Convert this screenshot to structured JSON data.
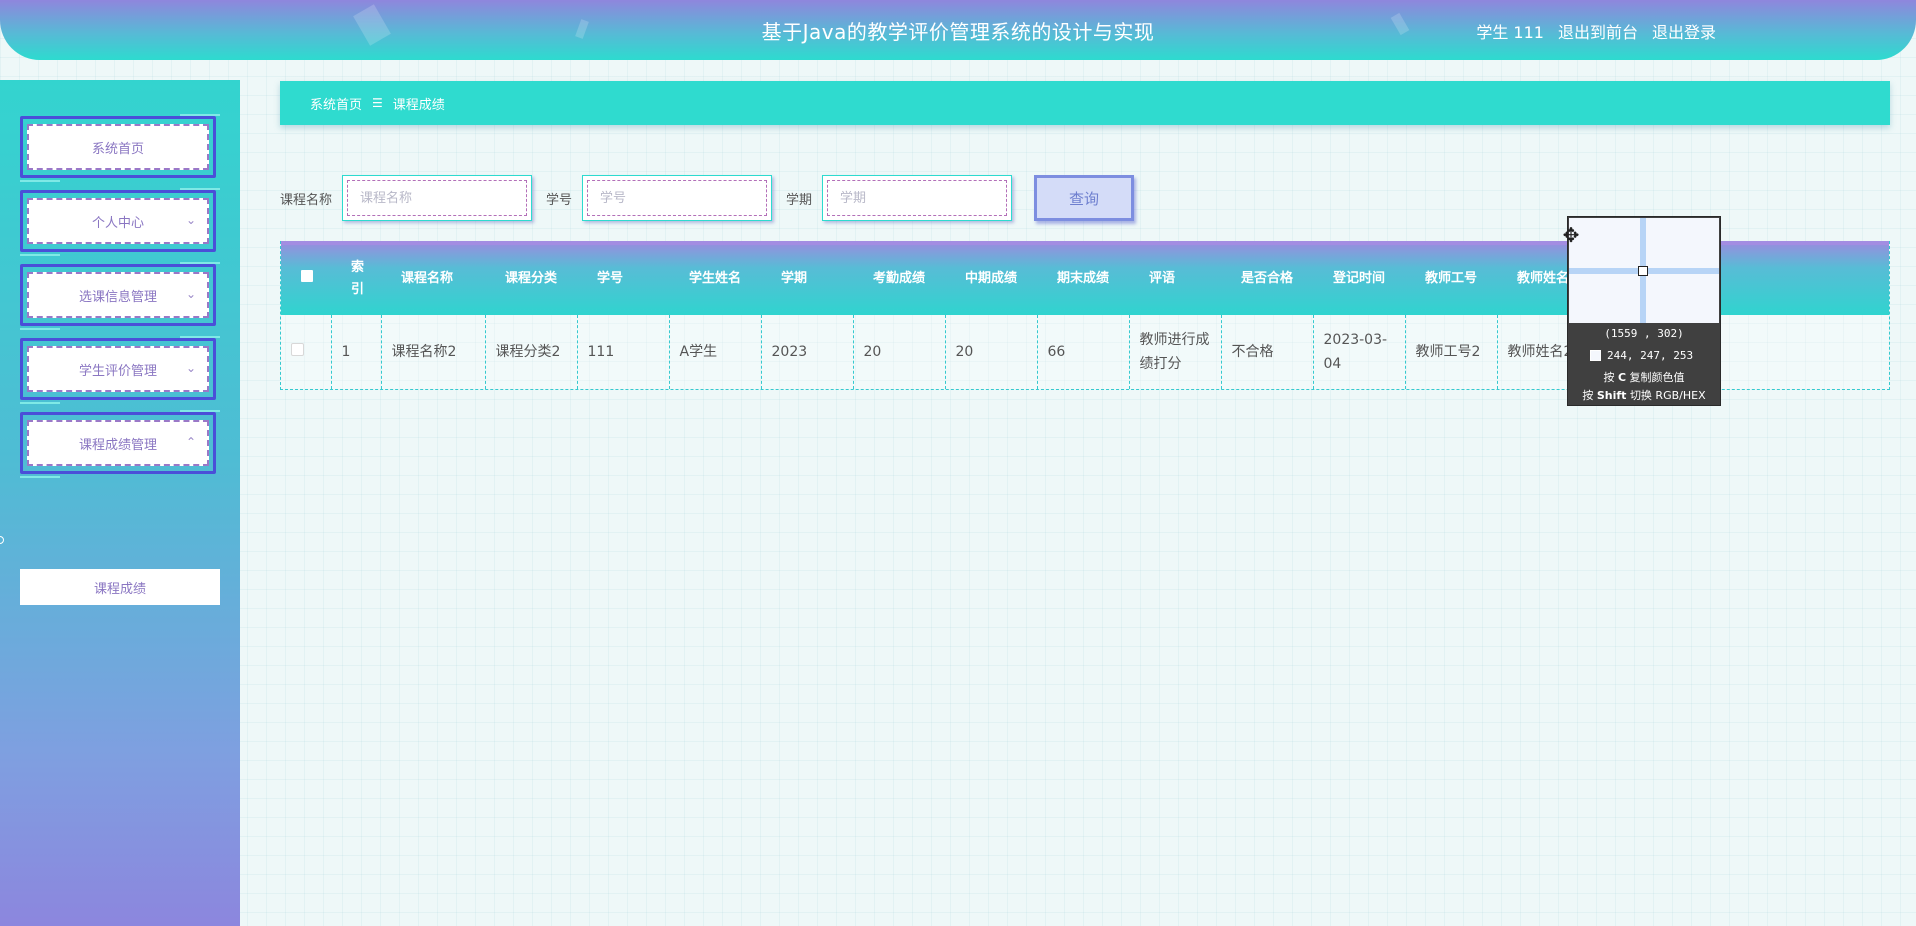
{
  "header": {
    "title": "基于Java的教学评价管理系统的设计与实现",
    "user_label": "学生 111",
    "front_link": "退出到前台",
    "logout_link": "退出登录"
  },
  "sidebar": {
    "items": [
      {
        "label": "系统首页",
        "has_chevron": false
      },
      {
        "label": "个人中心",
        "chevron": "⌄"
      },
      {
        "label": "选课信息管理",
        "chevron": "⌄"
      },
      {
        "label": "学生评价管理",
        "chevron": "⌄"
      },
      {
        "label": "课程成绩管理",
        "chevron": "⌃"
      }
    ],
    "submenu_item": "课程成绩"
  },
  "breadcrumb": {
    "home": "系统首页",
    "separator": "☰",
    "current": "课程成绩"
  },
  "search": {
    "course_label": "课程名称",
    "course_placeholder": "课程名称",
    "student_no_label": "学号",
    "student_no_placeholder": "学号",
    "term_label": "学期",
    "term_placeholder": "学期",
    "query_button": "查询"
  },
  "table": {
    "headers": [
      "索引",
      "课程名称",
      "课程分类",
      "学号",
      "学生姓名",
      "学期",
      "考勤成绩",
      "中期成绩",
      "期末成绩",
      "评语",
      "是否合格",
      "登记时间",
      "教师工号",
      "教师姓名"
    ],
    "rows": [
      {
        "index": "1",
        "course_name": "课程名称2",
        "course_category": "课程分类2",
        "student_no": "111",
        "student_name": "A学生",
        "term": "2023",
        "attendance_score": "20",
        "midterm_score": "20",
        "final_score": "66",
        "comment": "教师进行成绩打分",
        "passed": "不合格",
        "register_time": "2023-03-04",
        "teacher_no": "教师工号2",
        "teacher_name": "教师姓名2"
      }
    ]
  },
  "color_picker": {
    "coords": "(1559 , 302)",
    "rgb": "244, 247, 253",
    "swatch_color": "#f4f7fd",
    "hint_copy_prefix": "按",
    "hint_copy_key": "C",
    "hint_copy_suffix": "复制颜色值",
    "hint_toggle_prefix": "按",
    "hint_toggle_key": "Shift",
    "hint_toggle_suffix": "切换 RGB/HEX"
  }
}
